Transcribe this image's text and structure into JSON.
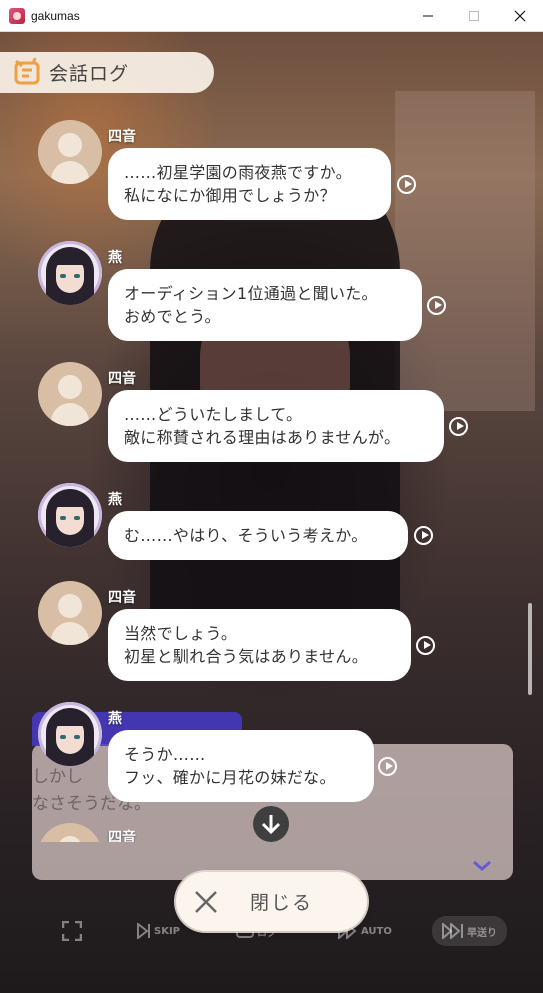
{
  "window": {
    "title": "gakumas",
    "controls": [
      "minimize",
      "maximize",
      "close"
    ]
  },
  "log": {
    "title": "会話ログ",
    "icon": "chat-log-icon"
  },
  "messages": [
    {
      "speaker": "四音",
      "avatar": "placeholder",
      "text": "……初星学園の雨夜燕ですか。\n私になにか御用でしょうか？"
    },
    {
      "speaker": "燕",
      "avatar": "portrait",
      "text": "オーディション1位通過と聞いた。\nおめでとう。"
    },
    {
      "speaker": "四音",
      "avatar": "placeholder",
      "text": "……どういたしまして。\n敵に称賛される理由はありませんが。"
    },
    {
      "speaker": "燕",
      "avatar": "portrait",
      "text": "む……やはり、そういう考えか。"
    },
    {
      "speaker": "四音",
      "avatar": "placeholder",
      "text": "当然でしょう。\n初星と馴れ合う気はありません。"
    },
    {
      "speaker": "燕",
      "avatar": "portrait",
      "text": "そうか……\nフッ、確かに月花の妹だな。"
    },
    {
      "speaker": "四音",
      "avatar": "placeholder",
      "text": ""
    }
  ],
  "game_dialog": {
    "text": "しかし\nなさそうだな。"
  },
  "controls": {
    "skip": "SKIP",
    "log": "ログ",
    "auto": "AUTO",
    "fast": "早送り"
  },
  "close_button": {
    "label": "閉じる"
  },
  "colors": {
    "bubble": "#ffffff",
    "header_bg": "#faf2e8",
    "accent_orange": "#f0a040",
    "avatar_placeholder": "#d7bea5"
  }
}
